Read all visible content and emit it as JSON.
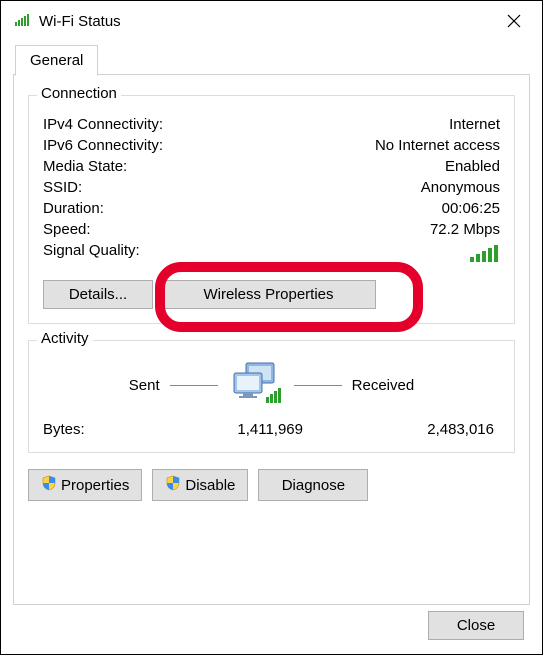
{
  "window": {
    "title": "Wi-Fi Status",
    "close_tooltip": "Close"
  },
  "tabs": {
    "general": "General"
  },
  "connection": {
    "legend": "Connection",
    "ipv4_label": "IPv4 Connectivity:",
    "ipv4_value": "Internet",
    "ipv6_label": "IPv6 Connectivity:",
    "ipv6_value": "No Internet access",
    "media_label": "Media State:",
    "media_value": "Enabled",
    "ssid_label": "SSID:",
    "ssid_value": "Anonymous",
    "duration_label": "Duration:",
    "duration_value": "00:06:25",
    "speed_label": "Speed:",
    "speed_value": "72.2 Mbps",
    "signal_label": "Signal Quality:",
    "details_btn": "Details...",
    "wireless_btn": "Wireless Properties"
  },
  "activity": {
    "legend": "Activity",
    "sent_label": "Sent",
    "received_label": "Received",
    "bytes_label": "Bytes:",
    "bytes_sent": "1,411,969",
    "bytes_received": "2,483,016"
  },
  "buttons": {
    "properties": "Properties",
    "disable": "Disable",
    "diagnose": "Diagnose",
    "close": "Close"
  }
}
